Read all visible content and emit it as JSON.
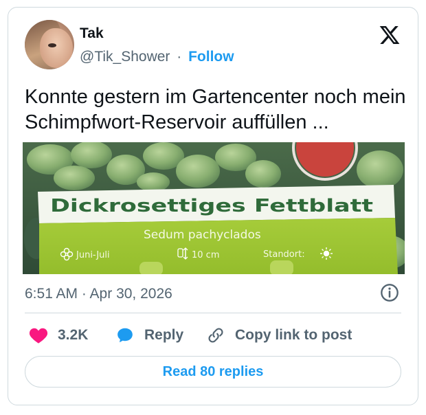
{
  "author": {
    "name": "Tak",
    "handle": "@Tik_Shower",
    "separator": "·",
    "follow_label": "Follow"
  },
  "tweet": {
    "text": "Konnte gestern im Gartencenter noch mein Schimpfwort-Reservoir auffüllen ..."
  },
  "media": {
    "plant_title": "Dickrosettiges Fettblatt",
    "plant_latin": "Sedum pachyclados",
    "bloom": "Juni-Juli",
    "height": "10 cm",
    "location": "Standort:"
  },
  "meta": {
    "timestamp": "6:51 AM · Apr 30, 2026"
  },
  "actions": {
    "likes": "3.2K",
    "reply_label": "Reply",
    "copy_label": "Copy link to post",
    "read_replies_label": "Read 80 replies"
  },
  "colors": {
    "accent": "#1d9bf0",
    "like": "#f91880",
    "text": "#0f1419",
    "muted": "#536471",
    "border": "#cfd9de"
  },
  "icons": [
    "x-logo-icon",
    "info-icon",
    "heart-icon",
    "reply-bubble-icon",
    "link-icon"
  ]
}
